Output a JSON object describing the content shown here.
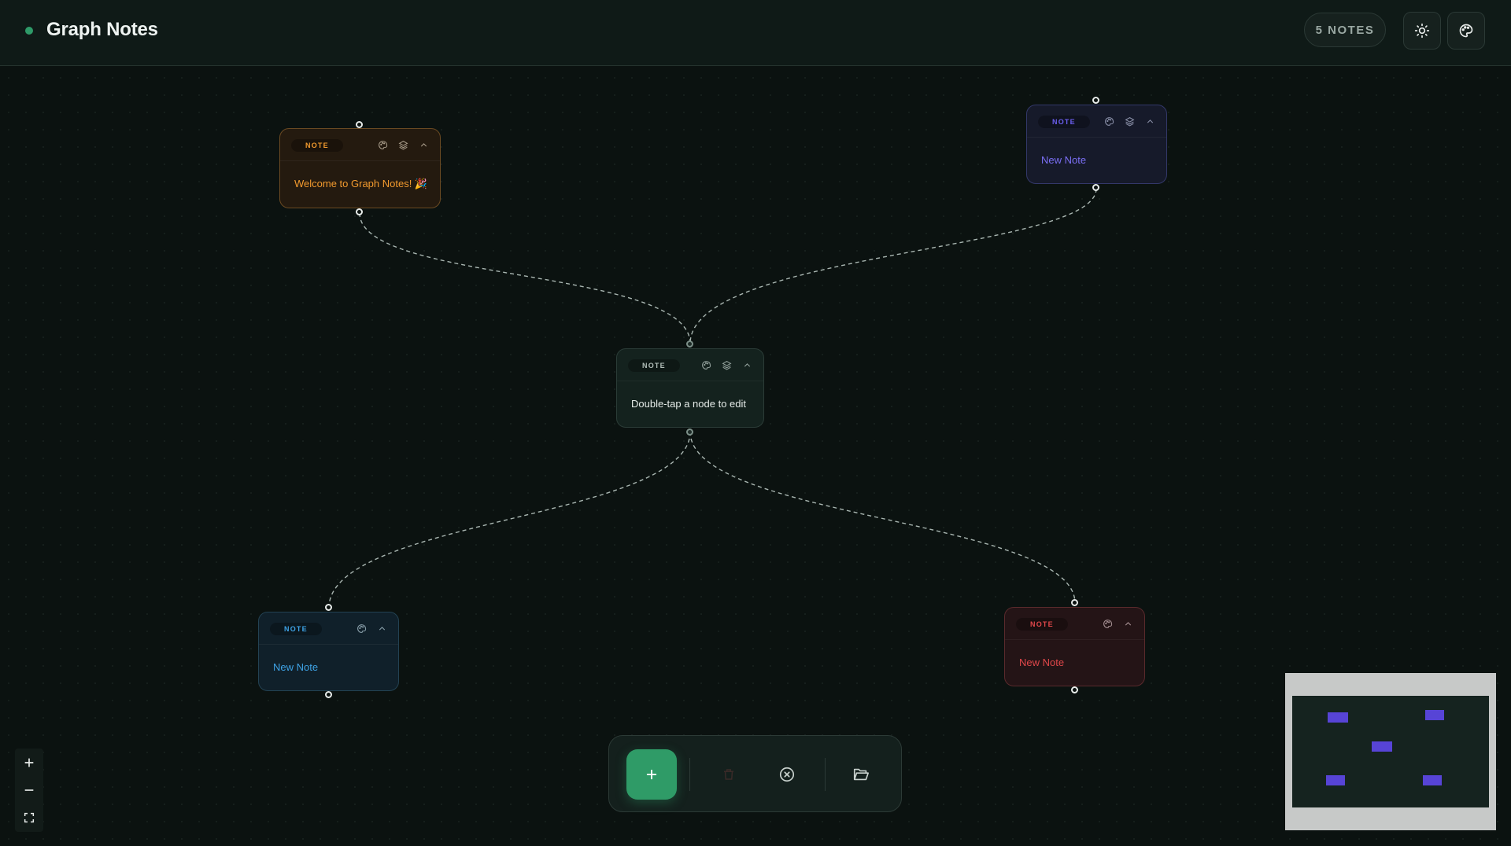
{
  "app": {
    "title": "Graph Notes",
    "note_count_label": "5 NOTES",
    "accent_color": "#2e9a68"
  },
  "header_buttons": {
    "theme_icon": "sun-icon",
    "palette_icon": "palette-icon"
  },
  "nodes": [
    {
      "id": "welcome",
      "tag": "NOTE",
      "text": "Welcome to Graph Notes! 🎉",
      "color": "#f29a2e",
      "has_layers": true
    },
    {
      "id": "top-right",
      "tag": "NOTE",
      "text": "New Note",
      "color": "#6b5ff0",
      "has_layers": true
    },
    {
      "id": "center",
      "tag": "NOTE",
      "text": "Double-tap a node to edit",
      "color": "#cfd8d4",
      "has_layers": true
    },
    {
      "id": "bottom-left",
      "tag": "NOTE",
      "text": "New Note",
      "color": "#3ea3e6",
      "has_layers": false
    },
    {
      "id": "bottom-right",
      "tag": "NOTE",
      "text": "New Note",
      "color": "#e0474a",
      "has_layers": false
    }
  ],
  "node_tools": [
    "palette-icon",
    "layers-icon",
    "chevron-up-icon"
  ],
  "toolbar": {
    "add_icon": "plus-icon",
    "delete_icon": "trash-icon",
    "clear_icon": "x-circle-icon",
    "open_icon": "folder-open-icon"
  },
  "zoom_controls": [
    "zoom-in-icon",
    "zoom-out-icon",
    "fit-view-icon"
  ],
  "minimap": {
    "node_color": "#5744d6"
  }
}
